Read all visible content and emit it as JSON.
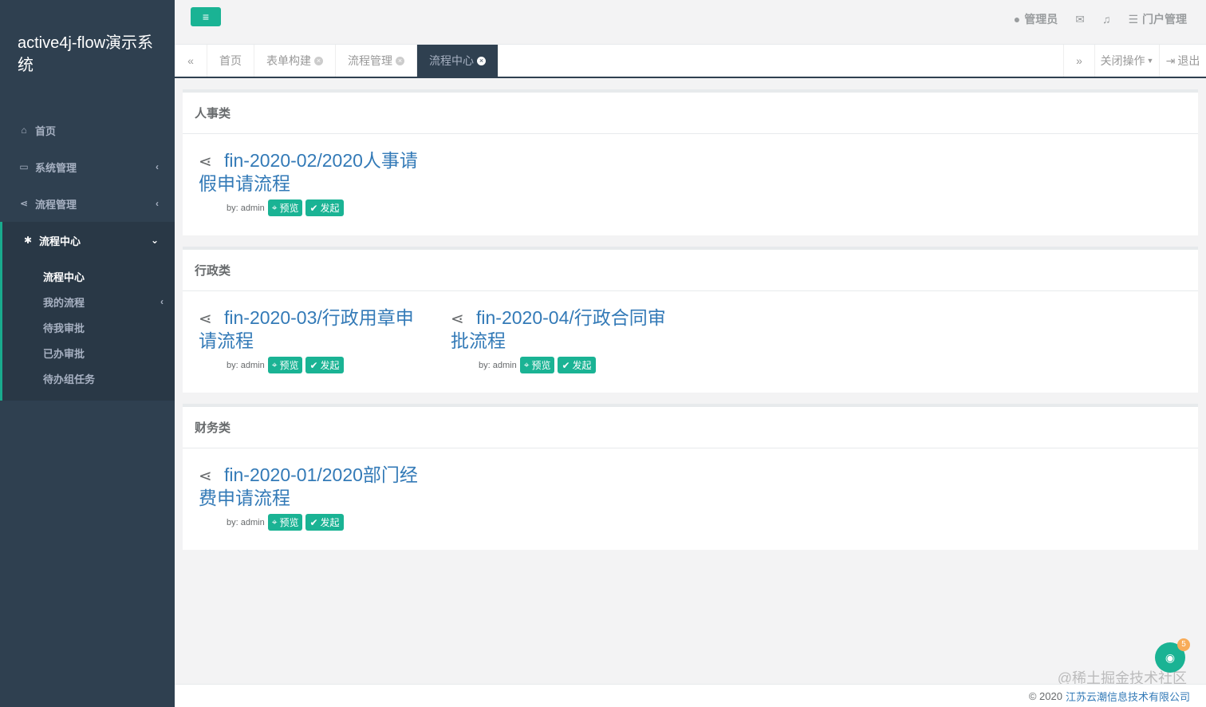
{
  "brand": {
    "title": "active4j-flow演示系统"
  },
  "sidebar": {
    "items": [
      {
        "icon": "home-icon",
        "glyph": "⌂",
        "label": "首页"
      },
      {
        "icon": "monitor-icon",
        "glyph": "▭",
        "label": "系统管理"
      },
      {
        "icon": "share-icon",
        "glyph": "⋖",
        "label": "流程管理"
      },
      {
        "icon": "gear-icon",
        "glyph": "✱",
        "label": "流程中心"
      }
    ],
    "subitems": [
      {
        "label": "流程中心"
      },
      {
        "label": "我的流程"
      },
      {
        "label": "待我审批"
      },
      {
        "label": "已办审批"
      },
      {
        "label": "待办组任务"
      }
    ]
  },
  "topbar": {
    "menu_glyph": "≡",
    "user": "管理员",
    "portal": "门户管理"
  },
  "tabs": {
    "items": [
      {
        "label": "首页"
      },
      {
        "label": "表单构建"
      },
      {
        "label": "流程管理"
      },
      {
        "label": "流程中心"
      }
    ],
    "close_ops": "关闭操作",
    "logout": "退出"
  },
  "categories": [
    {
      "title": "人事类",
      "flows": [
        {
          "title": "fin-2020-02/2020人事请假申请流程",
          "by": "by: admin",
          "preview": "预览",
          "start": "发起"
        }
      ]
    },
    {
      "title": "行政类",
      "flows": [
        {
          "title": "fin-2020-03/行政用章申请流程",
          "by": "by: admin",
          "preview": "预览",
          "start": "发起"
        },
        {
          "title": "fin-2020-04/行政合同审批流程",
          "by": "by: admin",
          "preview": "预览",
          "start": "发起"
        }
      ]
    },
    {
      "title": "财务类",
      "flows": [
        {
          "title": "fin-2020-01/2020部门经费申请流程",
          "by": "by: admin",
          "preview": "预览",
          "start": "发起"
        }
      ]
    }
  ],
  "footer": {
    "copyright": "© 2020",
    "company": "江苏云潮信息技术有限公司"
  },
  "watermark": "@稀土掘金技术社区",
  "chat": {
    "badge": "5"
  },
  "colors": {
    "sidebar": "#2f4050",
    "accent": "#1ab394",
    "link": "#337ab7"
  }
}
